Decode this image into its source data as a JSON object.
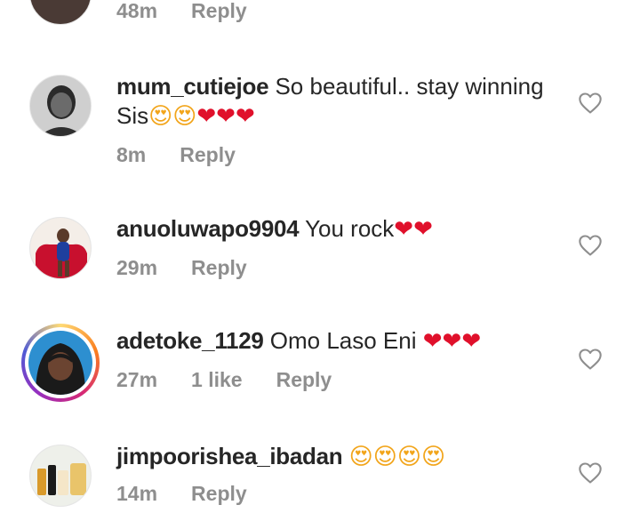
{
  "comments": [
    {
      "username": "",
      "text": "",
      "time": "48m",
      "likes": "",
      "reply_label": "Reply"
    },
    {
      "username": "mum_cutiejoe",
      "text": "So beautiful.. stay winning Sis",
      "emojis": "😍😍❤❤❤",
      "time": "8m",
      "likes": "",
      "reply_label": "Reply"
    },
    {
      "username": "anuoluwapo9904",
      "text": "You rock",
      "emojis": "❤❤",
      "time": "29m",
      "likes": "",
      "reply_label": "Reply"
    },
    {
      "username": "adetoke_1129",
      "text": "Omo Laso Eni",
      "emojis": "❤❤❤",
      "time": "27m",
      "likes": "1 like",
      "reply_label": "Reply"
    },
    {
      "username": "jimpoorishea_ibadan",
      "text": "",
      "emojis": "😍😍😍😍",
      "time": "14m",
      "likes": "",
      "reply_label": "Reply"
    }
  ],
  "icons": {
    "like": "heart-outline-icon"
  },
  "colors": {
    "username": "#262626",
    "meta": "#8e8e8e",
    "heart": "#e0102b"
  }
}
